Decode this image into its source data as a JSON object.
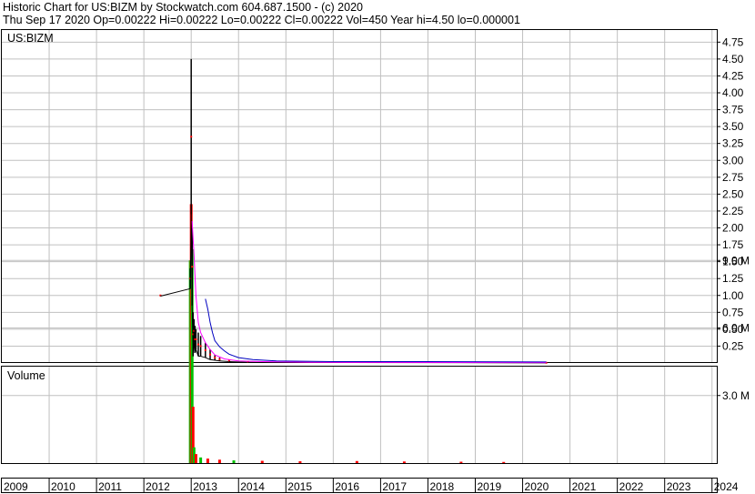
{
  "header": {
    "line1": "Historic Chart for US:BIZM by Stockwatch.com 604.687.1500 - (c) 2020",
    "line2": "Thu Sep 17 2020   Op=0.00222   Hi=0.00222   Lo=0.00222   Cl=0.00222   Vol=450   Year hi=4.50   lo=0.000001"
  },
  "chart_data": [
    {
      "type": "line",
      "title": "US:BIZM",
      "ylim": [
        0,
        4.9
      ],
      "y_ticks": [
        "0.25",
        "0.50",
        "0.75",
        "1.00",
        "1.25",
        "1.50",
        "1.75",
        "2.00",
        "2.25",
        "2.50",
        "2.75",
        "3.00",
        "3.25",
        "3.50",
        "3.75",
        "4.00",
        "4.25",
        "4.50",
        "4.75"
      ],
      "x_ticks": [
        "2009",
        "2010",
        "2011",
        "2012",
        "2013",
        "2014",
        "2015",
        "2016",
        "2017",
        "2018",
        "2019",
        "2020",
        "2021",
        "2022",
        "2023",
        "2024"
      ],
      "grid": true,
      "colors": {
        "price": "#000000",
        "close_marks": "#ff0000",
        "ma_short": "#ff00ff",
        "ma_long": "#0000c0",
        "grid": "#c0c0c0"
      },
      "series": [
        {
          "key": "price_range",
          "x": [
            2012.35,
            2012.98,
            2013.0,
            2013.02,
            2013.04,
            2013.06,
            2013.08,
            2013.1,
            2013.15,
            2013.2,
            2013.3,
            2013.4,
            2013.5,
            2013.6,
            2013.8,
            2014.2,
            2020.5
          ],
          "low": [
            0.99,
            1.1,
            2.2,
            0.85,
            0.1,
            0.3,
            0.15,
            0.2,
            0.1,
            0.1,
            0.08,
            0.05,
            0.04,
            0.03,
            0.02,
            0.01,
            0.002
          ],
          "high": [
            1.01,
            1.4,
            4.5,
            2.0,
            0.75,
            0.65,
            0.55,
            0.5,
            0.45,
            0.4,
            0.3,
            0.2,
            0.12,
            0.08,
            0.05,
            0.03,
            0.005
          ]
        },
        {
          "key": "ma_short",
          "x": [
            2013.02,
            2013.06,
            2013.1,
            2013.15,
            2013.2,
            2013.3,
            2013.4,
            2013.5,
            2013.7,
            2014.0,
            2014.5,
            2015.5,
            2017.0,
            2020.5
          ],
          "values": [
            2.1,
            1.6,
            1.0,
            0.6,
            0.45,
            0.3,
            0.2,
            0.12,
            0.06,
            0.03,
            0.02,
            0.01,
            0.008,
            0.005
          ]
        },
        {
          "key": "ma_long",
          "x": [
            2013.3,
            2013.35,
            2013.4,
            2013.45,
            2013.5,
            2013.6,
            2013.7,
            2013.8,
            2014.0,
            2014.3,
            2014.8,
            2016.0,
            2018.0,
            2020.5
          ],
          "values": [
            0.95,
            0.8,
            0.6,
            0.45,
            0.33,
            0.24,
            0.18,
            0.13,
            0.08,
            0.05,
            0.03,
            0.02,
            0.02,
            0.015
          ]
        }
      ]
    },
    {
      "type": "bar",
      "title": "Volume",
      "ylim": [
        0,
        12000000
      ],
      "y_ticks": [
        "3.0 M",
        "6.0 M",
        "9.0 M"
      ],
      "y_tick_values": [
        3000000,
        6000000,
        9000000
      ],
      "colors": {
        "up": "#00c000",
        "down": "#ff0000"
      },
      "bars": [
        {
          "x": 2012.98,
          "value": 9000000,
          "color": "up"
        },
        {
          "x": 2013.0,
          "value": 11500000,
          "color": "down"
        },
        {
          "x": 2013.02,
          "value": 9500000,
          "color": "up"
        },
        {
          "x": 2013.04,
          "value": 2500000,
          "color": "down"
        },
        {
          "x": 2013.06,
          "value": 700000,
          "color": "up"
        },
        {
          "x": 2013.1,
          "value": 400000,
          "color": "down"
        },
        {
          "x": 2013.2,
          "value": 250000,
          "color": "up"
        },
        {
          "x": 2013.35,
          "value": 200000,
          "color": "down"
        },
        {
          "x": 2013.6,
          "value": 150000,
          "color": "down"
        },
        {
          "x": 2013.9,
          "value": 120000,
          "color": "up"
        },
        {
          "x": 2014.5,
          "value": 100000,
          "color": "down"
        },
        {
          "x": 2015.3,
          "value": 80000,
          "color": "down"
        },
        {
          "x": 2016.5,
          "value": 90000,
          "color": "down"
        },
        {
          "x": 2017.5,
          "value": 70000,
          "color": "down"
        },
        {
          "x": 2018.7,
          "value": 60000,
          "color": "down"
        },
        {
          "x": 2019.6,
          "value": 50000,
          "color": "down"
        }
      ]
    }
  ]
}
